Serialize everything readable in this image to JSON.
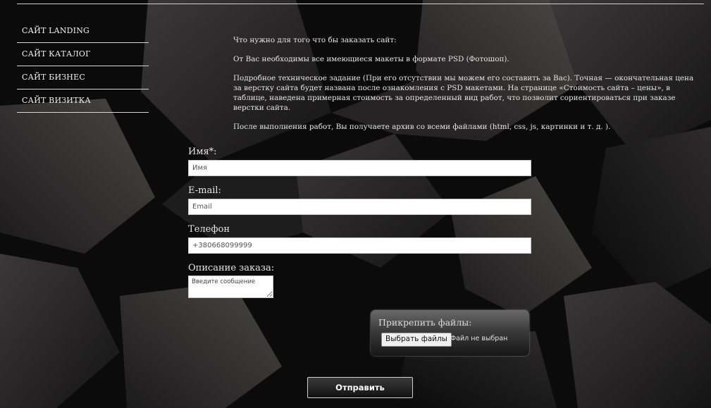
{
  "nav": {
    "items": [
      {
        "label": "САЙТ LANDING"
      },
      {
        "label": "САЙТ КАТАЛОГ"
      },
      {
        "label": "САЙТ БИЗНЕС"
      },
      {
        "label": "САЙТ ВИЗИТКА"
      }
    ]
  },
  "info": {
    "p1": "Что нужно для того что бы заказать сайт:",
    "p2": "От Вас необходимы все имеющиеся макеты в формате PSD (Фотошоп).",
    "p3": "Подробное техническое задание (При его отсутствии мы можем его составить за Вас). Точная — окончательная цена за верстку сайта будет названа после ознакомления с PSD макетами. На странице «Стоимость сайта – цены»,   в таблице, наведена примерная стоимость за определенный вид работ, что позволит сориентироваться при заказе верстки сайта.",
    "p4": "После выполнения работ, Вы получаете архив со всеми файлами (html, css, js, картинки и т. д. )."
  },
  "form": {
    "name_label": "Имя*:",
    "name_placeholder": "Имя",
    "email_label": "E-mail:",
    "email_placeholder": "Email",
    "phone_label": "Телефон",
    "phone_placeholder": "+380668099999",
    "description_label": "Описание заказа:",
    "description_placeholder": "Введите сообщение",
    "attach_title": "Прикрепить файлы:",
    "file_button": "Выбрать файлы",
    "file_status": "Файл не выбран",
    "submit_label": "Отправить"
  }
}
